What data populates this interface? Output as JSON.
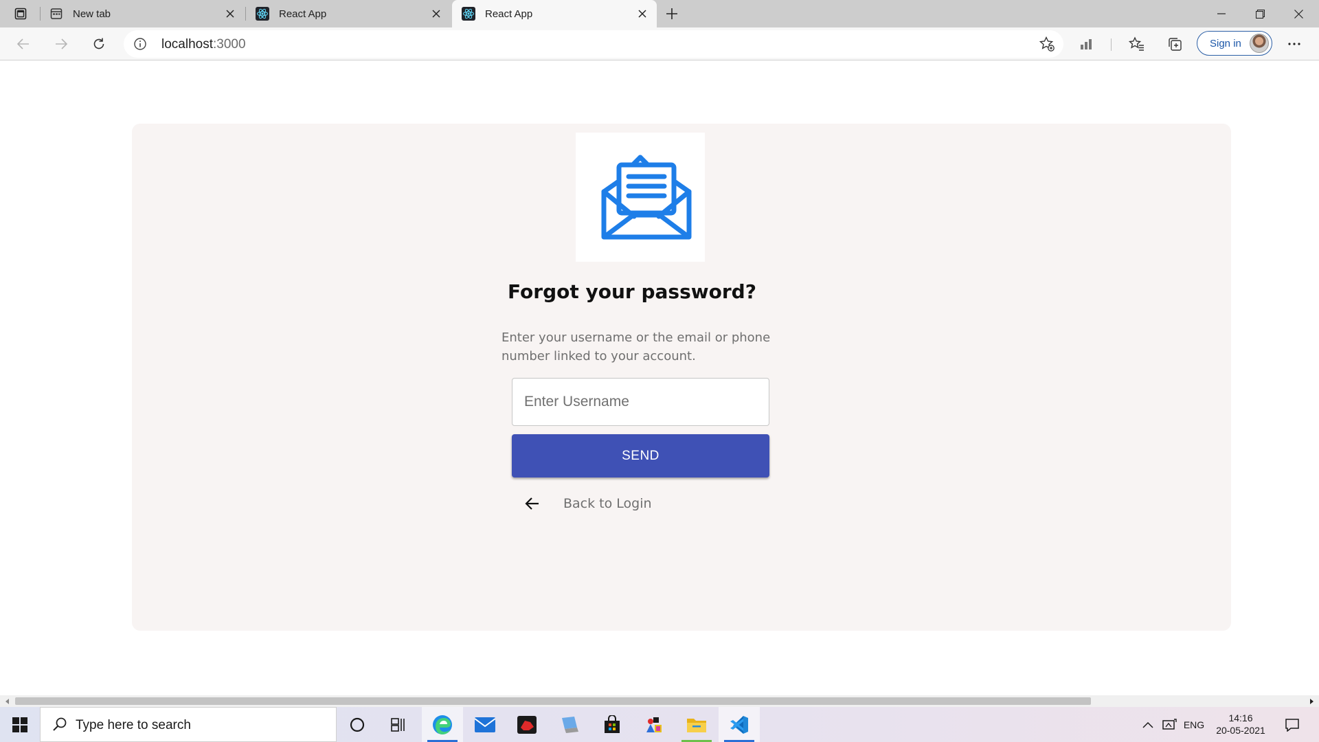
{
  "browser": {
    "tabs": [
      {
        "title": "New tab"
      },
      {
        "title": "React App"
      },
      {
        "title": "React App",
        "active": true
      }
    ],
    "address": {
      "host": "localhost",
      "port": ":3000"
    },
    "signin_label": "Sign in"
  },
  "page": {
    "title": "Forgot your password?",
    "description": "Enter your username or the email or phone number linked to your account.",
    "username_placeholder": "Enter Username",
    "send_label": "SEND",
    "back_label": "Back to Login"
  },
  "taskbar": {
    "search_placeholder": "Type here to search",
    "language": "ENG",
    "time": "14:16",
    "date": "20-05-2021"
  },
  "colors": {
    "accent": "#3f51b5",
    "envelope": "#1e7ee8",
    "card_background": "#f8f4f3"
  }
}
